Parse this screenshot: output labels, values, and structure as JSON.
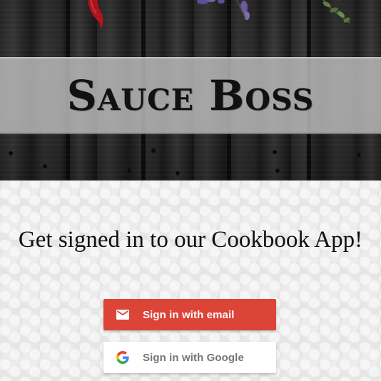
{
  "header": {
    "title": "Sauce Boss"
  },
  "main": {
    "headline": "Get signed in to our Cookbook App!"
  },
  "auth": {
    "email_button": {
      "label": "Sign in with email",
      "icon": "mail-icon",
      "background": "#db4437",
      "text_color": "#ffffff"
    },
    "google_button": {
      "label": "Sign in with Google",
      "icon": "google-icon",
      "background": "#ffffff",
      "text_color": "#757575"
    }
  }
}
